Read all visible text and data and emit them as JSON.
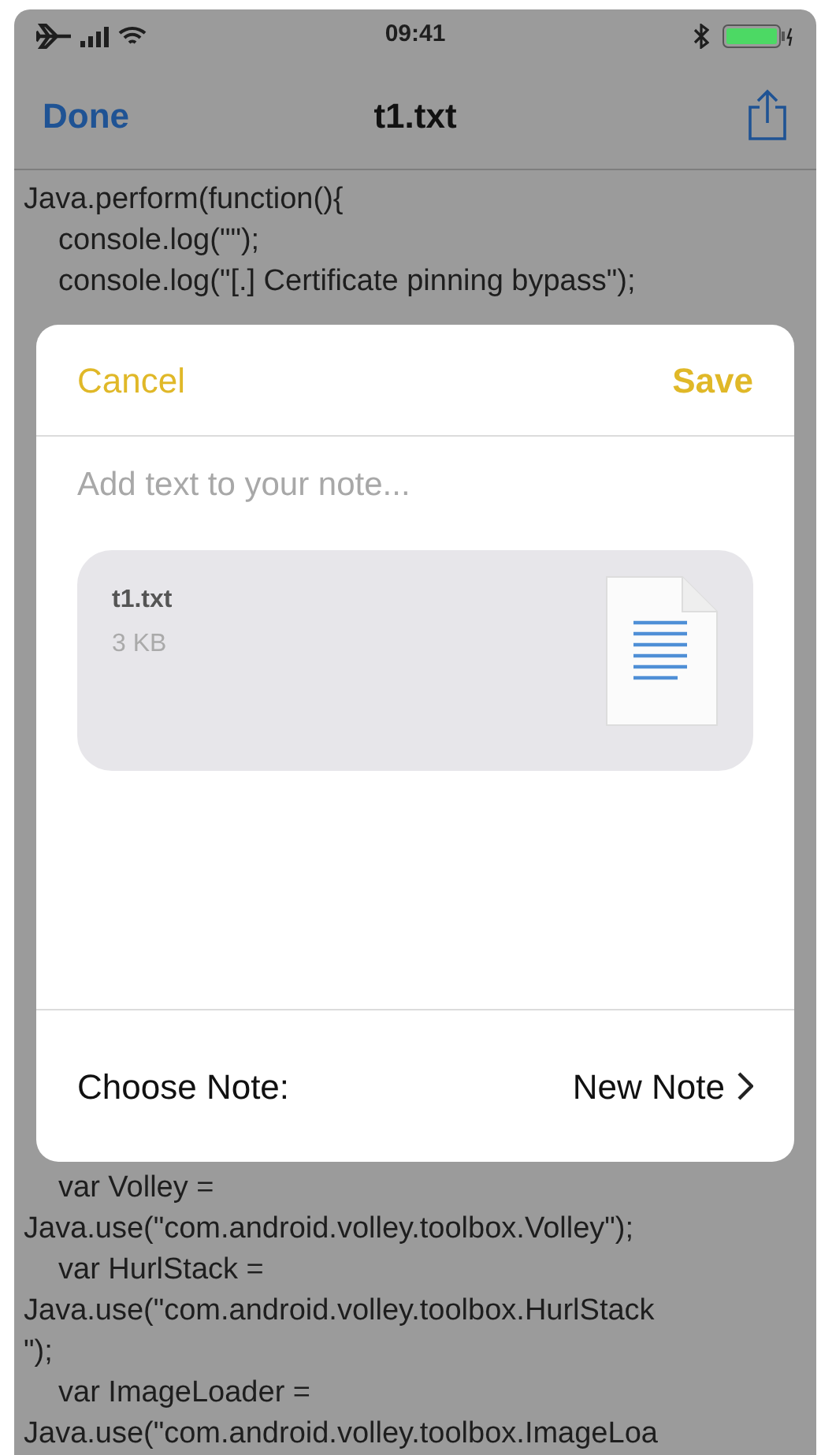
{
  "status_bar": {
    "time": "09:41"
  },
  "nav_bar": {
    "left_button": "Done",
    "title": "t1.txt"
  },
  "code_above": [
    {
      "text": "Java.perform(function(){",
      "indented": false
    },
    {
      "text": "console.log(\"\");",
      "indented": true
    },
    {
      "text": "console.log(\"[.] Certificate pinning bypass\");",
      "indented": true
    }
  ],
  "sheet": {
    "cancel": "Cancel",
    "save": "Save",
    "note_placeholder": "Add text to your note...",
    "attachment": {
      "name": "t1.txt",
      "size": "3 KB"
    },
    "choose_note_label": "Choose Note:",
    "choose_note_value": "New Note"
  },
  "code_below": [
    {
      "text": "var Volley =",
      "indented": true
    },
    {
      "text": "Java.use(\"com.android.volley.toolbox.Volley\");",
      "indented": false
    },
    {
      "text": "var HurlStack =",
      "indented": true
    },
    {
      "text": "Java.use(\"com.android.volley.toolbox.HurlStack",
      "indented": false
    },
    {
      "text": "\");",
      "indented": false
    },
    {
      "text": "var ImageLoader =",
      "indented": true
    },
    {
      "text": "Java.use(\"com.android.volley.toolbox.ImageLoa",
      "indented": false
    }
  ]
}
